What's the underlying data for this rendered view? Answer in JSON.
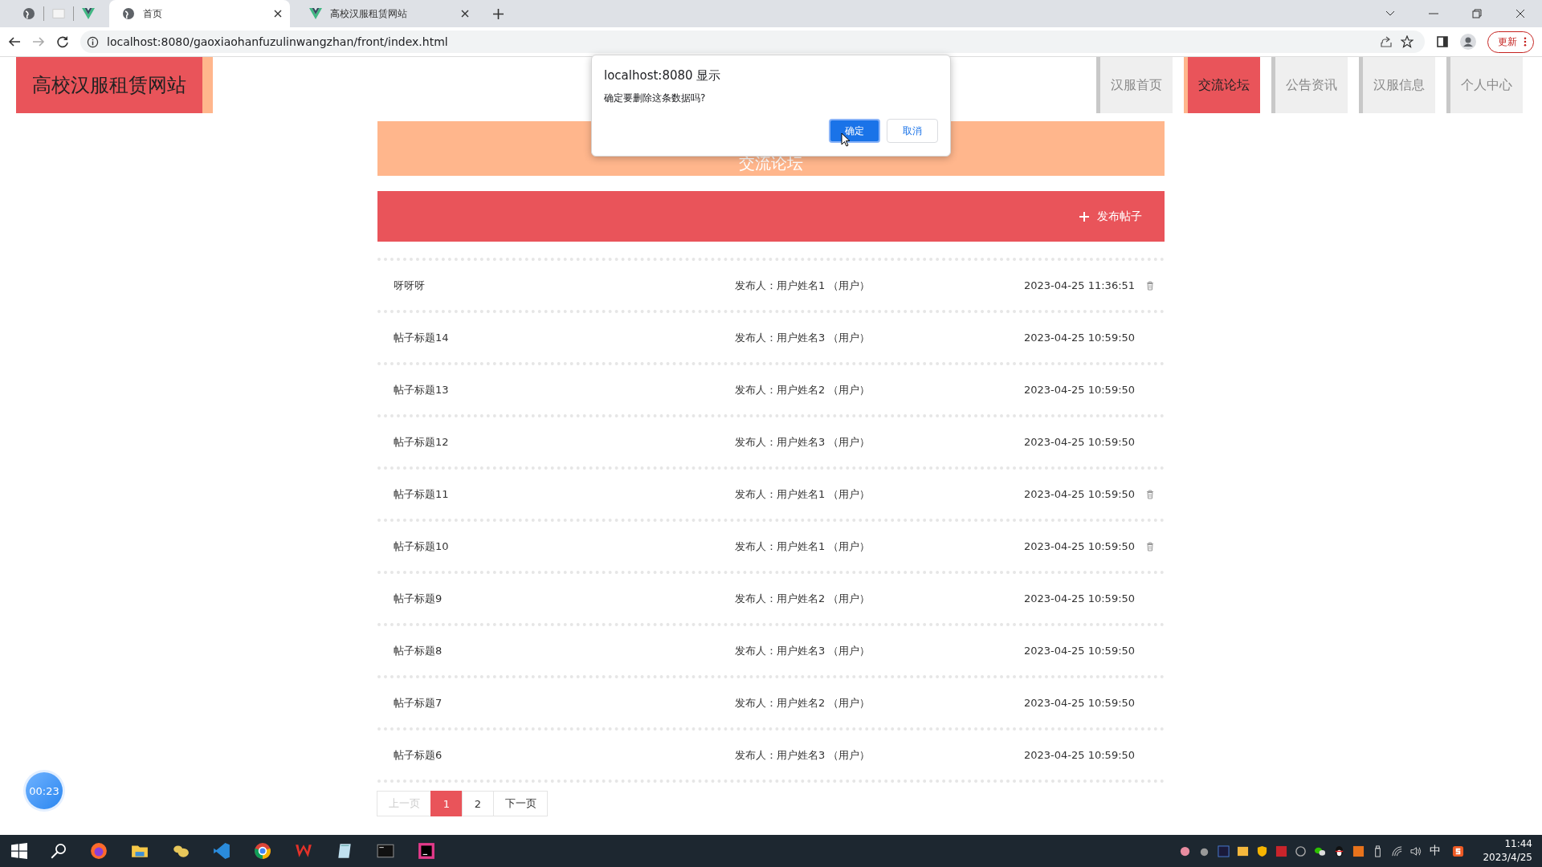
{
  "browser": {
    "tabs": [
      {
        "title": "首页",
        "selected": true,
        "kind": "globe"
      },
      {
        "title": "高校汉服租赁网站",
        "selected": false,
        "kind": "vue"
      }
    ],
    "url": "localhost:8080/gaoxiaohanfuzulinwangzhan/front/index.html",
    "update_button": "更新"
  },
  "site": {
    "logo": "高校汉服租赁网站",
    "nav": [
      {
        "label": "汉服首页",
        "selected": false
      },
      {
        "label": "交流论坛",
        "selected": true
      },
      {
        "label": "公告资讯",
        "selected": false
      },
      {
        "label": "汉服信息",
        "selected": false
      },
      {
        "label": "个人中心",
        "selected": false
      }
    ]
  },
  "banner": {
    "title": "交流论坛"
  },
  "post_button": "发布帖子",
  "posts": [
    {
      "title": "呀呀呀",
      "publisher": "发布人：用户姓名1 （用户）",
      "time": "2023-04-25 11:36:51",
      "deletable": true
    },
    {
      "title": "帖子标题14",
      "publisher": "发布人：用户姓名3 （用户）",
      "time": "2023-04-25 10:59:50",
      "deletable": false
    },
    {
      "title": "帖子标题13",
      "publisher": "发布人：用户姓名2 （用户）",
      "time": "2023-04-25 10:59:50",
      "deletable": false
    },
    {
      "title": "帖子标题12",
      "publisher": "发布人：用户姓名3 （用户）",
      "time": "2023-04-25 10:59:50",
      "deletable": false
    },
    {
      "title": "帖子标题11",
      "publisher": "发布人：用户姓名1 （用户）",
      "time": "2023-04-25 10:59:50",
      "deletable": true
    },
    {
      "title": "帖子标题10",
      "publisher": "发布人：用户姓名1 （用户）",
      "time": "2023-04-25 10:59:50",
      "deletable": true
    },
    {
      "title": "帖子标题9",
      "publisher": "发布人：用户姓名2 （用户）",
      "time": "2023-04-25 10:59:50",
      "deletable": false
    },
    {
      "title": "帖子标题8",
      "publisher": "发布人：用户姓名3 （用户）",
      "time": "2023-04-25 10:59:50",
      "deletable": false
    },
    {
      "title": "帖子标题7",
      "publisher": "发布人：用户姓名2 （用户）",
      "time": "2023-04-25 10:59:50",
      "deletable": false
    },
    {
      "title": "帖子标题6",
      "publisher": "发布人：用户姓名3 （用户）",
      "time": "2023-04-25 10:59:50",
      "deletable": false
    }
  ],
  "pagination": {
    "prev": {
      "label": "上一页",
      "disabled": true
    },
    "pages": [
      {
        "label": "1",
        "selected": true
      },
      {
        "label": "2",
        "selected": false
      }
    ],
    "next": {
      "label": "下一页",
      "disabled": false
    }
  },
  "timer": "00:23",
  "dialog": {
    "title": "localhost:8080 显示",
    "message": "确定要删除这条数据吗?",
    "confirm": "确定",
    "cancel": "取消"
  },
  "taskbar": {
    "ime": "中",
    "time": "11:44",
    "date": "2023/4/25"
  }
}
